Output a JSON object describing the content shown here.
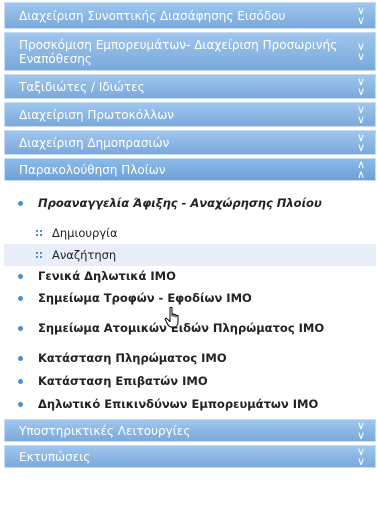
{
  "menu": {
    "sections_top": [
      {
        "label": "Διαχείριση Συνοπτικής Διασάφησης Εισόδου"
      },
      {
        "label": "Προσκόμιση Εμπορευμάτων- Διαχείριση Προσωρινής Εναπόθεσης"
      },
      {
        "label": "Ταξιδιώτες / Ιδιώτες"
      },
      {
        "label": "Διαχείριση Πρωτοκόλλων"
      },
      {
        "label": "Διαχείριση Δημοπρασιών"
      }
    ],
    "active_section": {
      "label": "Παρακολούθηση Πλοίων"
    },
    "items": [
      {
        "label": "Προαναγγελία Άφιξης - Αναχώρησης Πλοίου"
      },
      {
        "label": "Δημιουργία"
      },
      {
        "label": "Αναζήτηση"
      },
      {
        "label": "Γενικά Δηλωτικά IMO"
      },
      {
        "label": "Σημείωμα Τροφών - Εφοδίων IMO"
      },
      {
        "label": "Σημείωμα Ατομικών Ειδών Πληρώματος IMO"
      },
      {
        "label": "Κατάσταση Πληρώματος IMO"
      },
      {
        "label": "Κατάσταση Επιβατών IMO"
      },
      {
        "label": "Δηλωτικό Επικινδύνων Εμπορευμάτων IMO"
      }
    ],
    "sections_bottom": [
      {
        "label": "Υποστηρικτικές Λειτουργίες"
      },
      {
        "label": "Εκτυπώσεις"
      }
    ],
    "icons": {
      "expand": "chevron-double-down-icon",
      "collapse": "chevron-double-up-icon"
    }
  }
}
